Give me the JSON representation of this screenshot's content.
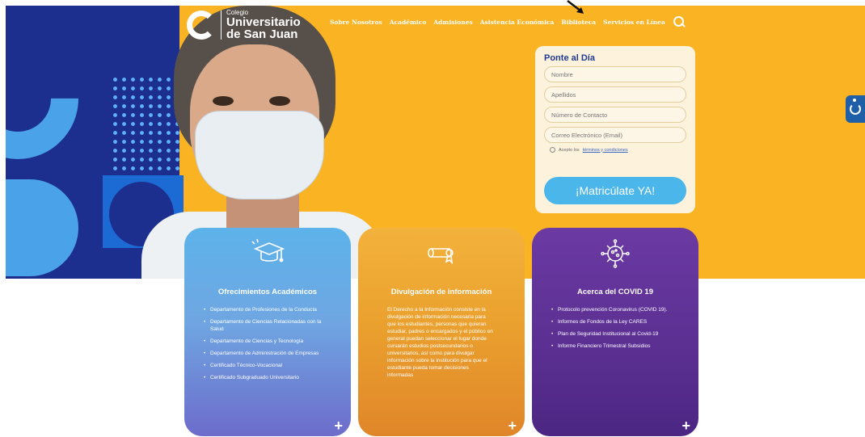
{
  "logo": {
    "line1": "Colegio",
    "line2": "Universitario",
    "line3": "de San Juan"
  },
  "nav": {
    "items": [
      "Sobre Nosotros",
      "Académico",
      "Admisiones",
      "Asistencia Económica",
      "Biblioteca",
      "Servicios en Línea"
    ],
    "search_icon": "search-icon"
  },
  "form": {
    "title": "Ponte al Día",
    "fields": {
      "name": "Nombre",
      "lastname": "Apellidos",
      "phone": "Número de Contacto",
      "email": "Correo Electrónico (Email)"
    },
    "consent_text": "Acepto los",
    "consent_link": "términos y condiciones",
    "cta": "¡Matricúlate YA!"
  },
  "cards": {
    "academic": {
      "title": "Ofrecimientos Académicos",
      "icon": "graduation-cap-icon",
      "items": [
        "Departamento de Profesiones de la Conducta",
        "Departamento de Ciencias Relacionadas con la Salud",
        "Departamento de Ciencias y Tecnología",
        "Departamento de Administración de Empresas",
        "Certificado Técnico-Vocacional",
        "Certificado Subgraduado Universitario"
      ]
    },
    "info": {
      "title": "Divulgación de información",
      "icon": "diploma-icon",
      "text": "El Derecho a la Información consiste en la divulgación de información necesaria para que los estudiantes, personas que quieran estudiar, padres o encargados y el público en general puedan seleccionar el lugar donde cursarán estudios postsecundarios o universitarios, así como para divulgar información sobre la institución para que el estudiante pueda tomar decisiones informadas"
    },
    "covid": {
      "title": "Acerca del COVID 19",
      "icon": "virus-icon",
      "items": [
        "Protocolo prevención Coronavirus (COVID 19).",
        "Informes de Fondos de la Ley CARES",
        "Plan de Seguridad Institucional al Covid-19",
        "Informe Financiero Trimestral Subsidios"
      ]
    },
    "plus": "+"
  },
  "colors": {
    "hero_yellow": "#f9b323",
    "hero_blue": "#1c2f8e",
    "cta_blue": "#4ab6ea",
    "card_academic": "#5db3ea",
    "card_info": "#ea9f2d",
    "card_covid": "#5a2f91"
  },
  "accessibility_icon": "accessibility-icon"
}
